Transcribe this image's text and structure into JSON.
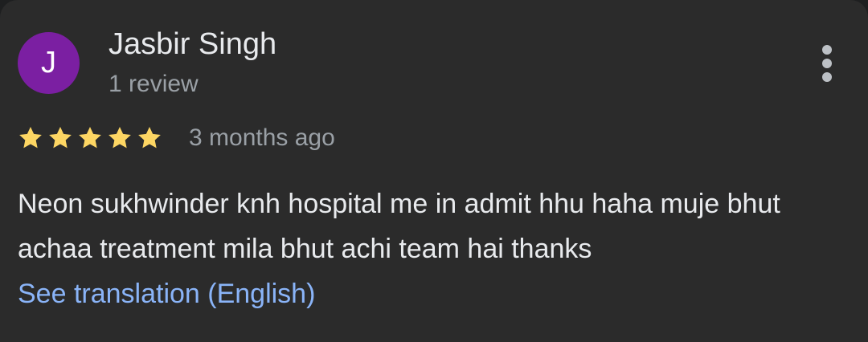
{
  "review": {
    "avatar_letter": "J",
    "author_name": "Jasbir Singh",
    "review_count": "1 review",
    "rating": 5,
    "rating_max": 5,
    "date": "3 months ago",
    "text": "Neon sukhwinder knh hospital me in admit hhu haha muje bhut achaa treatment mila bhut achi team hai thanks",
    "translation_link": "See translation (English)"
  },
  "icons": {
    "menu": "more-vert-icon",
    "rating": "star-icon"
  },
  "colors": {
    "card_background": "#2b2b2b",
    "avatar_background": "#7b1fa2",
    "star": "#fdd663",
    "primary_text": "#e8eaed",
    "secondary_text": "#9aa0a6",
    "link": "#8ab4f8"
  }
}
